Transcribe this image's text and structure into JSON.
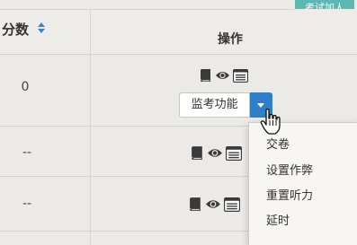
{
  "toolbar": {
    "add_exam_label": "考试加人"
  },
  "table": {
    "header": {
      "score_label": "分数",
      "actions_label": "操作"
    },
    "rows": [
      {
        "score": "0"
      },
      {
        "score": "--"
      },
      {
        "score": "--"
      }
    ],
    "row_icons": [
      "book-icon",
      "eye-icon",
      "list-icon"
    ]
  },
  "split_button": {
    "label": "监考功能",
    "state": "open"
  },
  "dropdown_menu": {
    "items": [
      {
        "label": "交卷"
      },
      {
        "label": "设置作弊"
      },
      {
        "label": "重置听力"
      },
      {
        "label": "延时"
      }
    ]
  },
  "colors": {
    "primary_blue": "#2f7ec8",
    "teal_button": "#5cb8b2",
    "background": "#eceae6"
  }
}
